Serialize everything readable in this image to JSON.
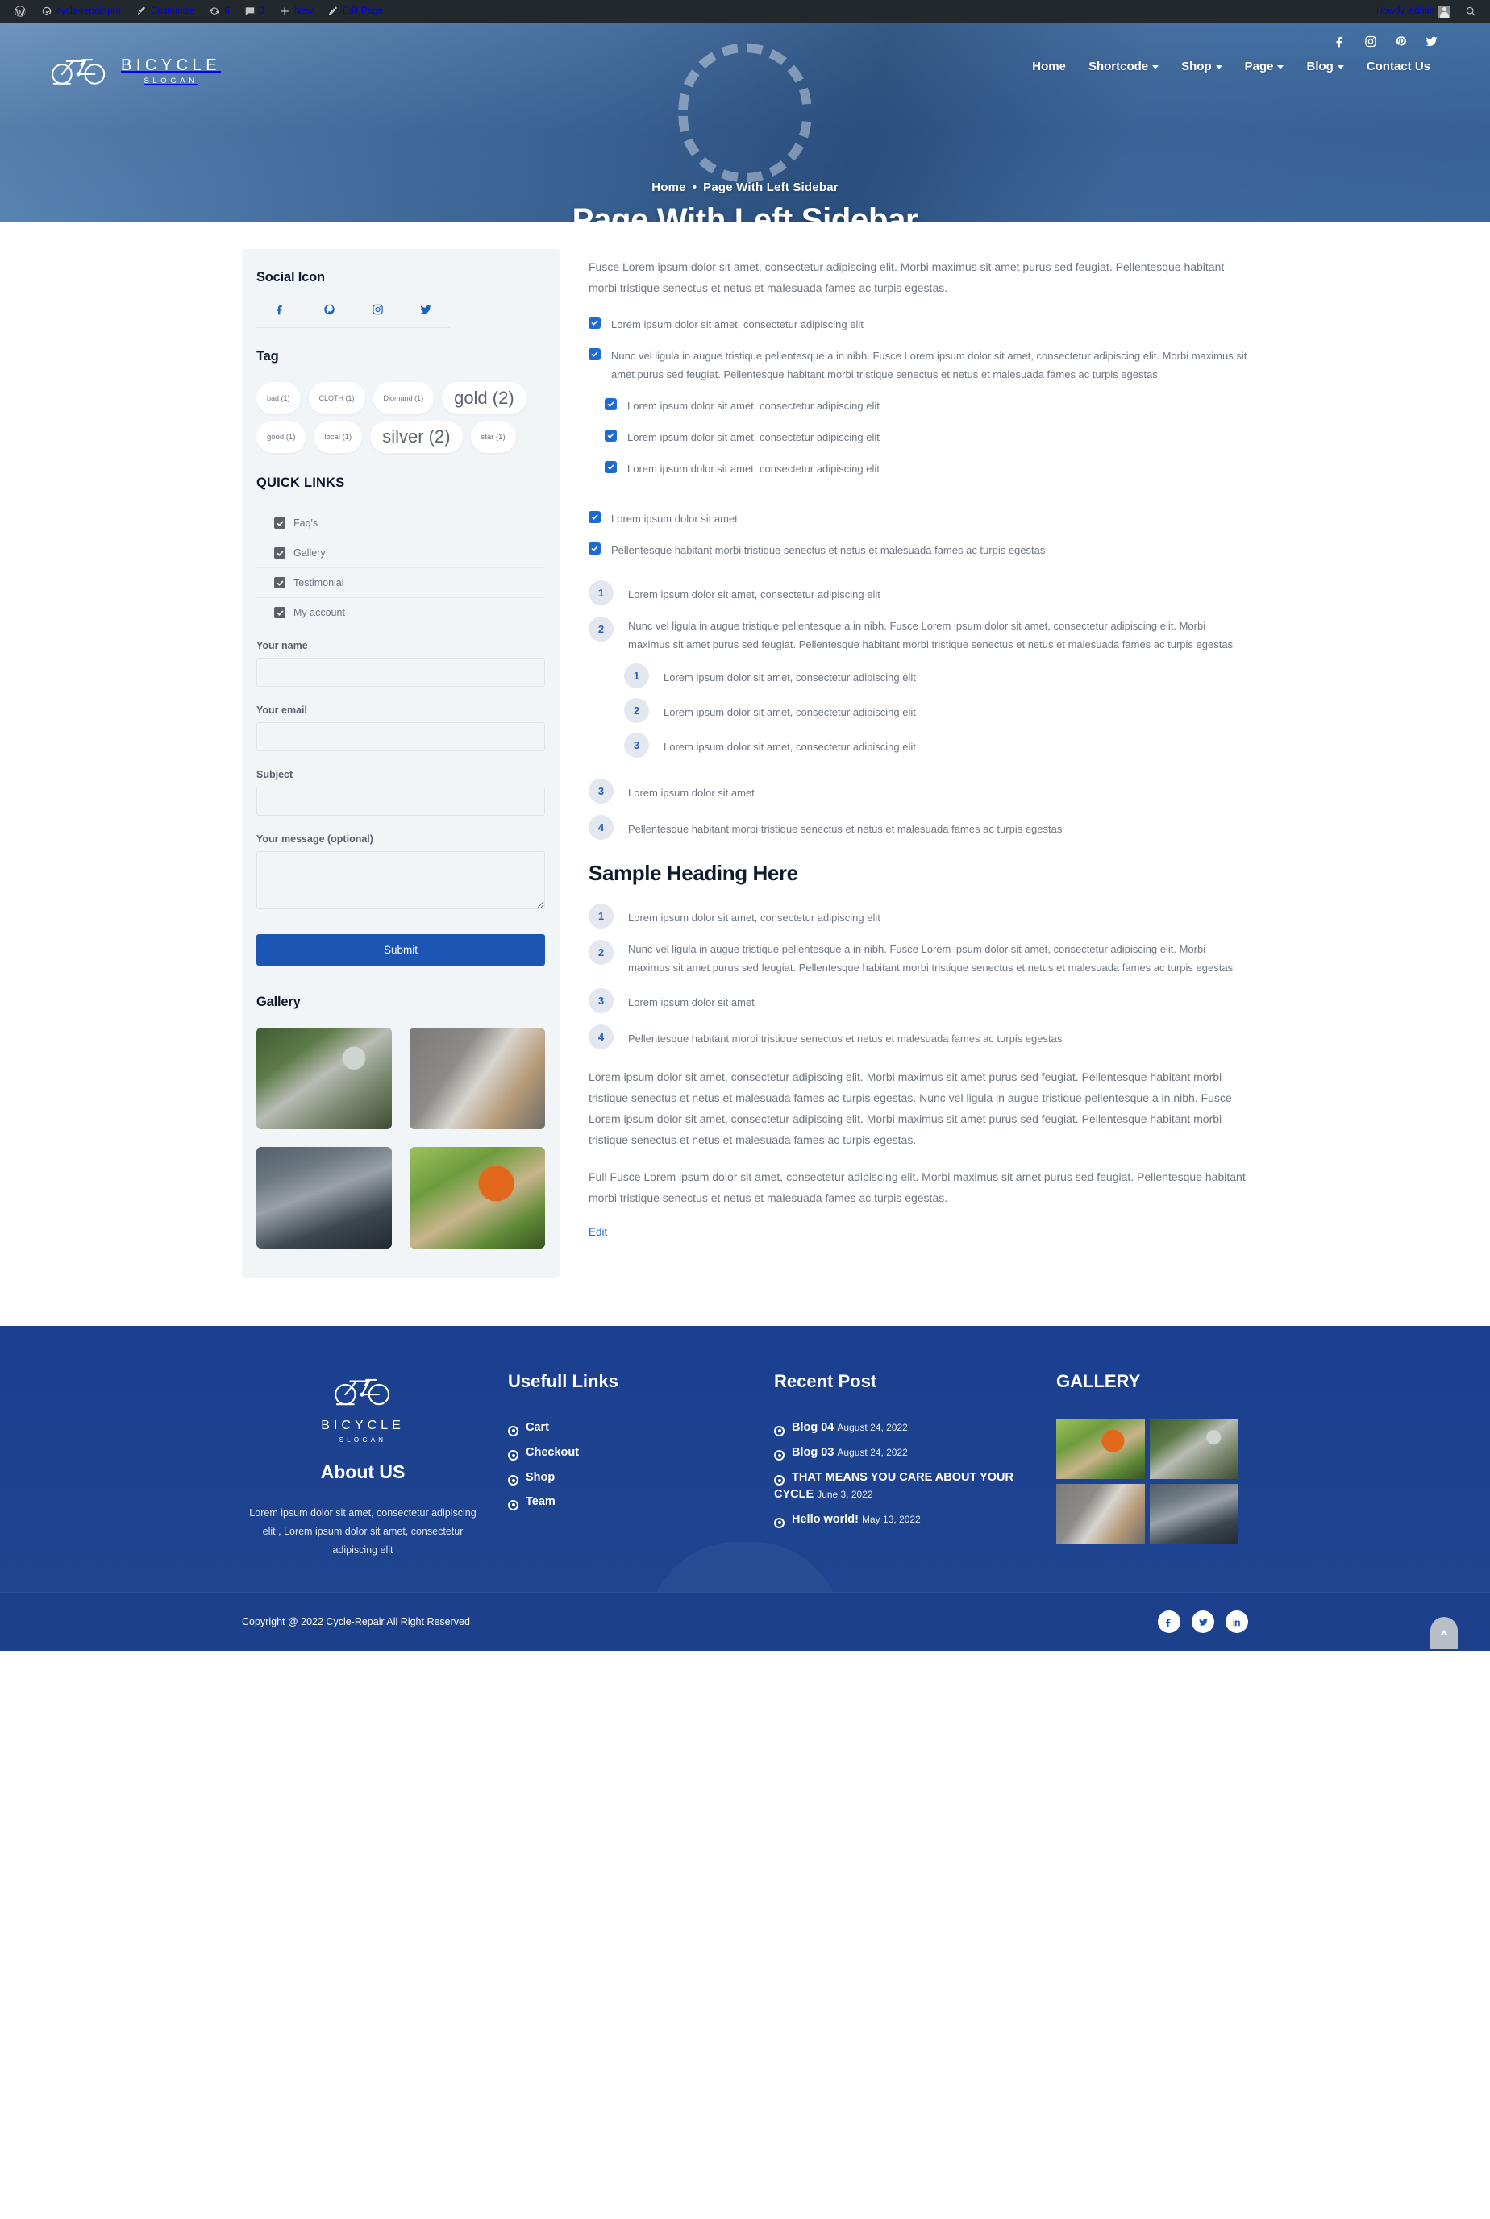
{
  "adminbar": {
    "items": [
      {
        "icon": "wordpress-icon",
        "label": ""
      },
      {
        "icon": "dashboard-icon",
        "label": "cycle-repair-pro"
      },
      {
        "icon": "paintbrush-icon",
        "label": "Customize"
      },
      {
        "icon": "updates-icon",
        "label": "6"
      },
      {
        "icon": "comments-icon",
        "label": "3"
      },
      {
        "icon": "plus-icon",
        "label": "New"
      },
      {
        "icon": "pencil-icon",
        "label": "Edit Page"
      }
    ],
    "howdy": "Howdy, admin",
    "search_icon": "search-icon"
  },
  "header": {
    "logo": {
      "name": "BICYCLE",
      "slogan": "SLOGAN",
      "icon": "bicycle-logo-icon"
    },
    "social": [
      {
        "icon": "facebook-icon",
        "label": "Facebook"
      },
      {
        "icon": "instagram-icon",
        "label": "Instagram"
      },
      {
        "icon": "pinterest-icon",
        "label": "Pinterest"
      },
      {
        "icon": "twitter-icon",
        "label": "Twitter"
      }
    ],
    "nav": [
      {
        "label": "Home",
        "has_dropdown": false
      },
      {
        "label": "Shortcode",
        "has_dropdown": true
      },
      {
        "label": "Shop",
        "has_dropdown": true
      },
      {
        "label": "Page",
        "has_dropdown": true
      },
      {
        "label": "Blog",
        "has_dropdown": true
      },
      {
        "label": "Contact Us",
        "has_dropdown": false
      }
    ],
    "breadcrumb_home": "Home",
    "breadcrumb_sep": "•",
    "breadcrumb_current": "Page With Left Sidebar",
    "page_title": "Page With Left Sidebar"
  },
  "sidebar": {
    "social_widget": {
      "title": "Social Icon",
      "icons": [
        {
          "icon": "facebook-icon",
          "label": "Facebook"
        },
        {
          "icon": "pinterest-icon",
          "label": "Pinterest"
        },
        {
          "icon": "instagram-icon",
          "label": "Instagram"
        },
        {
          "icon": "twitter-icon",
          "label": "Twitter"
        }
      ]
    },
    "tag_widget": {
      "title": "Tag",
      "tags": [
        {
          "label": "bad (1)",
          "size": "s1"
        },
        {
          "label": "CLOTH (1)",
          "size": "s1"
        },
        {
          "label": "Diomand (1)",
          "size": "s1"
        },
        {
          "label": "gold (2)",
          "size": "s3"
        },
        {
          "label": "good (1)",
          "size": "s2"
        },
        {
          "label": "local (1)",
          "size": "s2"
        },
        {
          "label": "silver (2)",
          "size": "s3"
        },
        {
          "label": "star (1)",
          "size": "s2"
        }
      ]
    },
    "quick_links": {
      "title": "QUICK LINKS",
      "items": [
        {
          "label": "Faq's"
        },
        {
          "label": "Gallery"
        },
        {
          "label": "Testimonial"
        },
        {
          "label": "My account"
        }
      ]
    },
    "contact_form": {
      "name_label": "Your name",
      "name_value": "",
      "email_label": "Your email",
      "email_value": "",
      "subject_label": "Subject",
      "subject_value": "",
      "message_label": "Your message (optional)",
      "message_value": "",
      "submit_label": "Submit"
    },
    "gallery": {
      "title": "Gallery",
      "images": [
        {
          "alt": "man-repairing-bicycle",
          "style": "ph-bike"
        },
        {
          "alt": "woman-on-laptop",
          "style": "ph-laptop"
        },
        {
          "alt": "team-meeting",
          "style": "ph-team"
        },
        {
          "alt": "gardener-trimming-hedge",
          "style": "ph-garden"
        }
      ]
    }
  },
  "content": {
    "intro": "Fusce Lorem ipsum dolor sit amet, consectetur adipiscing elit. Morbi maximus sit amet purus sed feugiat. Pellentesque habitant morbi tristique senectus et netus et malesuada fames ac turpis egestas.",
    "check_list": [
      {
        "text": "Lorem ipsum dolor sit amet, consectetur adipiscing elit"
      },
      {
        "text": "Nunc vel ligula in augue tristique pellentesque a in nibh. Fusce Lorem ipsum dolor sit amet, consectetur adipiscing elit. Morbi maximus sit amet purus sed feugiat. Pellentesque habitant morbi tristique senectus et netus et malesuada fames ac turpis egestas",
        "children": [
          {
            "text": "Lorem ipsum dolor sit amet, consectetur adipiscing elit"
          },
          {
            "text": "Lorem ipsum dolor sit amet, consectetur adipiscing elit"
          },
          {
            "text": "Lorem ipsum dolor sit amet, consectetur adipiscing elit"
          }
        ]
      },
      {
        "text": "Lorem ipsum dolor sit amet"
      },
      {
        "text": "Pellentesque habitant morbi tristique senectus et netus et malesuada fames ac turpis egestas"
      }
    ],
    "number_list_1": [
      {
        "n": "1",
        "text": "Lorem ipsum dolor sit amet, consectetur adipiscing elit"
      },
      {
        "n": "2",
        "text": "Nunc vel ligula in augue tristique pellentesque a in nibh. Fusce Lorem ipsum dolor sit amet, consectetur adipiscing elit. Morbi maximus sit amet purus sed feugiat. Pellentesque habitant morbi tristique senectus et netus et malesuada fames ac turpis egestas",
        "children": [
          {
            "n": "1",
            "text": "Lorem ipsum dolor sit amet, consectetur adipiscing elit"
          },
          {
            "n": "2",
            "text": "Lorem ipsum dolor sit amet, consectetur adipiscing elit"
          },
          {
            "n": "3",
            "text": "Lorem ipsum dolor sit amet, consectetur adipiscing elit"
          }
        ]
      },
      {
        "n": "3",
        "text": "Lorem ipsum dolor sit amet"
      },
      {
        "n": "4",
        "text": "Pellentesque habitant morbi tristique senectus et netus et malesuada fames ac turpis egestas"
      }
    ],
    "heading": "Sample Heading Here",
    "number_list_2": [
      {
        "n": "1",
        "text": "Lorem ipsum dolor sit amet, consectetur adipiscing elit"
      },
      {
        "n": "2",
        "text": "Nunc vel ligula in augue tristique pellentesque a in nibh. Fusce Lorem ipsum dolor sit amet, consectetur adipiscing elit. Morbi maximus sit amet purus sed feugiat. Pellentesque habitant morbi tristique senectus et netus et malesuada fames ac turpis egestas"
      },
      {
        "n": "3",
        "text": "Lorem ipsum dolor sit amet"
      },
      {
        "n": "4",
        "text": "Pellentesque habitant morbi tristique senectus et netus et malesuada fames ac turpis egestas"
      }
    ],
    "para_1": "Lorem ipsum dolor sit amet, consectetur adipiscing elit. Morbi maximus sit amet purus sed feugiat. Pellentesque habitant morbi tristique senectus et netus et malesuada fames ac turpis egestas. Nunc vel ligula in augue tristique pellentesque a in nibh. Fusce Lorem ipsum dolor sit amet, consectetur adipiscing elit. Morbi maximus sit amet purus sed feugiat. Pellentesque habitant morbi tristique senectus et netus et malesuada fames ac turpis egestas.",
    "para_2": "Full Fusce Lorem ipsum dolor sit amet, consectetur adipiscing elit. Morbi maximus sit amet purus sed feugiat. Pellentesque habitant morbi tristique senectus et netus et malesuada fames ac turpis egestas.",
    "edit_link": "Edit"
  },
  "footer": {
    "logo": {
      "name": "BICYCLE",
      "slogan": "SLOGAN",
      "icon": "bicycle-logo-icon"
    },
    "about_title": "About US",
    "about_text": "Lorem ipsum dolor sit amet, consectetur adipiscing elit , Lorem ipsum dolor sit amet, consectetur adipiscing elit",
    "links_title": "Usefull Links",
    "links": [
      {
        "label": "Cart"
      },
      {
        "label": "Checkout"
      },
      {
        "label": "Shop"
      },
      {
        "label": "Team"
      }
    ],
    "recent_title": "Recent Post",
    "recent": [
      {
        "title": "Blog 04",
        "date": "August 24, 2022"
      },
      {
        "title": "Blog 03",
        "date": "August 24, 2022"
      },
      {
        "title": "THAT MEANS YOU CARE ABOUT YOUR CYCLE",
        "date": "June 3, 2022"
      },
      {
        "title": "Hello world!",
        "date": "May 13, 2022"
      }
    ],
    "gallery_title": "GALLERY",
    "gallery": [
      {
        "alt": "gardener-trimming-hedge",
        "style": "ph-garden"
      },
      {
        "alt": "man-repairing-bicycle",
        "style": "ph-bike"
      },
      {
        "alt": "woman-on-laptop",
        "style": "ph-laptop"
      },
      {
        "alt": "team-meeting",
        "style": "ph-team"
      }
    ],
    "copyright": "Copyright @ 2022 Cycle-Repair All Right Reserved",
    "social": [
      {
        "icon": "facebook-icon",
        "label": "Facebook"
      },
      {
        "icon": "twitter-icon",
        "label": "Twitter"
      },
      {
        "icon": "linkedin-icon",
        "label": "LinkedIn"
      }
    ],
    "back_to_top": "back-to-top-icon"
  },
  "colors": {
    "accent": "#1c55b3",
    "footer_bg": "#1d428f",
    "admin_bg": "#23282d",
    "sidebar_bg": "#f2f5f8"
  }
}
